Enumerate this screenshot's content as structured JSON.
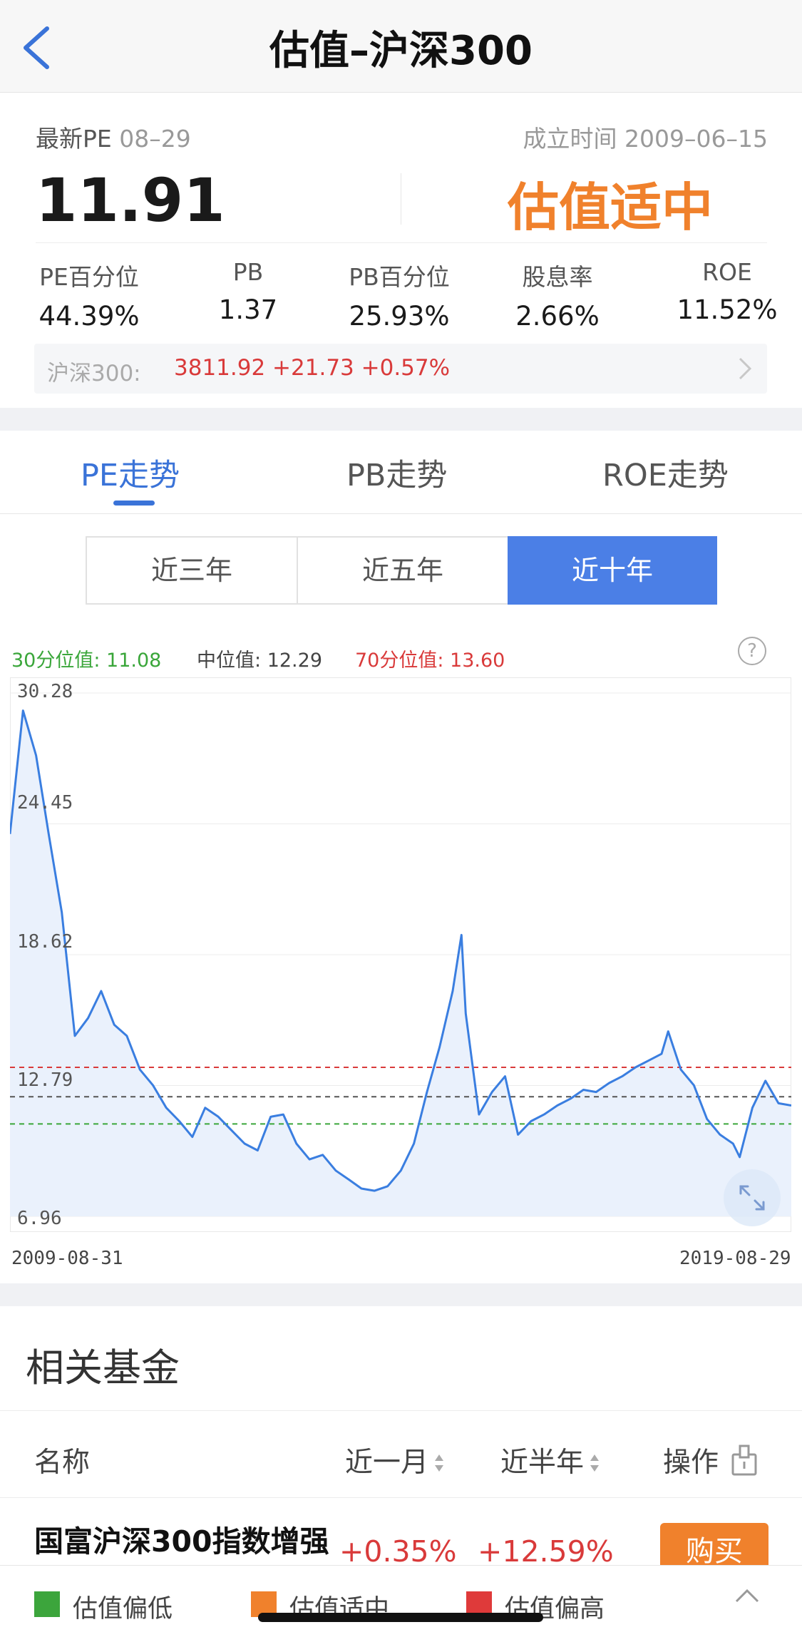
{
  "header": {
    "title": "估值–沪深300",
    "back_icon": "chevron-left-icon"
  },
  "summary": {
    "pe_label": "最新PE",
    "pe_date": "08–29",
    "inception_label": "成立时间",
    "inception_date": "2009–06–15",
    "pe_value": "11.91",
    "status": "估值适中",
    "status_color": "#f0812c"
  },
  "metrics": [
    {
      "label": "PE百分位",
      "value": "44.39%"
    },
    {
      "label": "PB",
      "value": "1.37"
    },
    {
      "label": "PB百分位",
      "value": "25.93%"
    },
    {
      "label": "股息率",
      "value": "2.66%"
    },
    {
      "label": "ROE",
      "value": "11.52%"
    }
  ],
  "index_quote": {
    "label": "沪深300:",
    "value": "3811.92 +21.73 +0.57%"
  },
  "tabs": [
    {
      "label": "PE走势",
      "active": true
    },
    {
      "label": "PB走势",
      "active": false
    },
    {
      "label": "ROE走势",
      "active": false
    }
  ],
  "ranges": [
    {
      "label": "近三年",
      "active": false
    },
    {
      "label": "近五年",
      "active": false
    },
    {
      "label": "近十年",
      "active": true
    }
  ],
  "percentiles": {
    "p30_label": "30分位值:",
    "p30_value": "11.08",
    "median_label": "中位值:",
    "median_value": "12.29",
    "p70_label": "70分位值:",
    "p70_value": "13.60",
    "help_icon": "question-circle-icon"
  },
  "chart_data": {
    "type": "line",
    "title": "",
    "series": [
      {
        "name": "",
        "x": [
          "2009-08-31",
          "2009-10-31",
          "2009-12-31",
          "2010-02-28",
          "2010-04-30",
          "2010-06-30",
          "2010-08-31",
          "2010-10-31",
          "2010-12-31",
          "2011-02-28",
          "2011-04-30",
          "2011-06-30",
          "2011-08-31",
          "2011-10-31",
          "2011-12-31",
          "2012-02-29",
          "2012-04-30",
          "2012-06-30",
          "2012-08-31",
          "2012-10-31",
          "2012-12-31",
          "2013-02-28",
          "2013-04-30",
          "2013-06-30",
          "2013-08-31",
          "2013-10-31",
          "2013-12-31",
          "2014-02-28",
          "2014-04-30",
          "2014-06-30",
          "2014-08-31",
          "2014-10-31",
          "2014-12-31",
          "2015-02-28",
          "2015-04-30",
          "2015-06-10",
          "2015-06-30",
          "2015-08-31",
          "2015-10-31",
          "2015-12-31",
          "2016-02-29",
          "2016-04-30",
          "2016-06-30",
          "2016-08-31",
          "2016-10-31",
          "2016-12-31",
          "2017-02-28",
          "2017-04-30",
          "2017-06-30",
          "2017-08-31",
          "2017-10-31",
          "2017-12-31",
          "2018-01-31",
          "2018-03-31",
          "2018-05-31",
          "2018-07-31",
          "2018-09-30",
          "2018-11-30",
          "2018-12-31",
          "2019-02-28",
          "2019-04-30",
          "2019-06-30",
          "2019-08-29"
        ],
        "y": [
          24.0,
          29.5,
          27.5,
          24.0,
          20.5,
          15.0,
          15.8,
          17.0,
          15.5,
          15.0,
          13.5,
          12.8,
          11.8,
          11.2,
          10.5,
          11.8,
          11.4,
          10.8,
          10.2,
          9.9,
          11.4,
          11.5,
          10.2,
          9.5,
          9.7,
          9.0,
          8.6,
          8.2,
          8.1,
          8.3,
          9.0,
          10.2,
          12.5,
          14.5,
          17.0,
          19.5,
          16.0,
          11.5,
          12.5,
          13.2,
          10.6,
          11.2,
          11.5,
          11.9,
          12.2,
          12.6,
          12.5,
          12.9,
          13.2,
          13.6,
          13.9,
          14.2,
          15.2,
          13.5,
          12.8,
          11.3,
          10.6,
          10.2,
          9.6,
          11.8,
          13.0,
          12.0,
          11.9
        ]
      }
    ],
    "reference_lines": [
      {
        "name": "30分位值",
        "value": 11.08,
        "color": "#3aa63a"
      },
      {
        "name": "中位值",
        "value": 12.29,
        "color": "#555555"
      },
      {
        "name": "70分位值",
        "value": 13.6,
        "color": "#d93a3a"
      }
    ],
    "y_ticks": [
      "30.28",
      "24.45",
      "18.62",
      "12.79",
      "6.96"
    ],
    "ylim": [
      6.96,
      30.28
    ],
    "x_range_labels": [
      "2009-08-31",
      "2019-08-29"
    ],
    "line_color": "#3a7ee0",
    "grid": true
  },
  "expand_icon": "expand-arrows-icon",
  "funds": {
    "title": "相关基金",
    "columns": {
      "name": "名称",
      "month": "近一月",
      "half_year": "近半年",
      "action": "操作"
    },
    "export_icon": "share-export-icon",
    "rows": [
      {
        "name": "国富沪深300指数增强",
        "month": "+0.35%",
        "half_year": "+12.59%",
        "action": "购买"
      }
    ]
  },
  "legend": [
    {
      "label": "估值偏低",
      "color": "#3ca53c"
    },
    {
      "label": "估值适中",
      "color": "#f0812c"
    },
    {
      "label": "估值偏高",
      "color": "#df3a3a"
    }
  ],
  "collapse_icon": "chevron-up-icon"
}
